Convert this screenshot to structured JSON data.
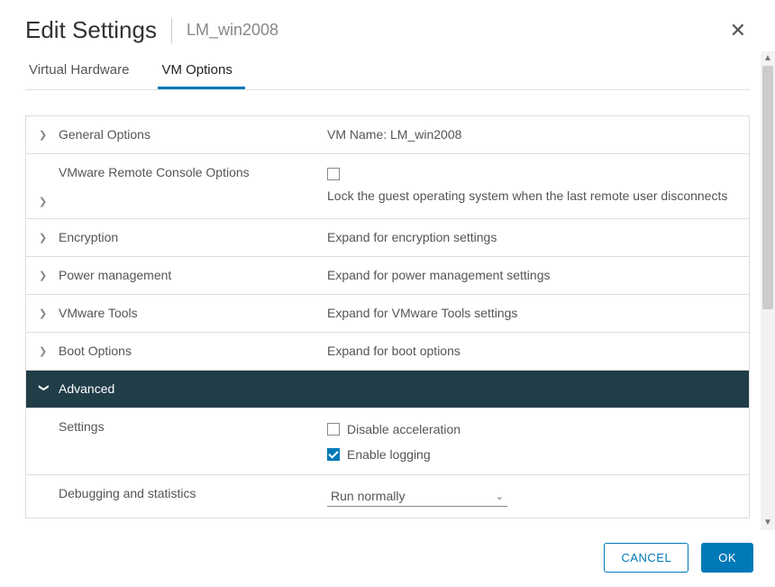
{
  "header": {
    "title": "Edit Settings",
    "subtitle": "LM_win2008"
  },
  "tabs": [
    {
      "label": "Virtual Hardware",
      "active": false
    },
    {
      "label": "VM Options",
      "active": true
    }
  ],
  "sections": {
    "general": {
      "label": "General Options",
      "summary": "VM Name: LM_win2008"
    },
    "remote_console": {
      "label": "VMware Remote Console Options",
      "checkbox_checked": false,
      "desc": "Lock the guest operating system when the last remote user disconnects"
    },
    "encryption": {
      "label": "Encryption",
      "summary": "Expand for encryption settings"
    },
    "power": {
      "label": "Power management",
      "summary": "Expand for power management settings"
    },
    "vmtools": {
      "label": "VMware Tools",
      "summary": "Expand for VMware Tools settings"
    },
    "boot": {
      "label": "Boot Options",
      "summary": "Expand for boot options"
    },
    "advanced": {
      "label": "Advanced",
      "settings_label": "Settings",
      "disable_accel_label": "Disable acceleration",
      "disable_accel_checked": false,
      "enable_logging_label": "Enable logging",
      "enable_logging_checked": true,
      "debug_label": "Debugging and statistics",
      "debug_value": "Run normally"
    }
  },
  "footer": {
    "cancel": "CANCEL",
    "ok": "OK"
  }
}
